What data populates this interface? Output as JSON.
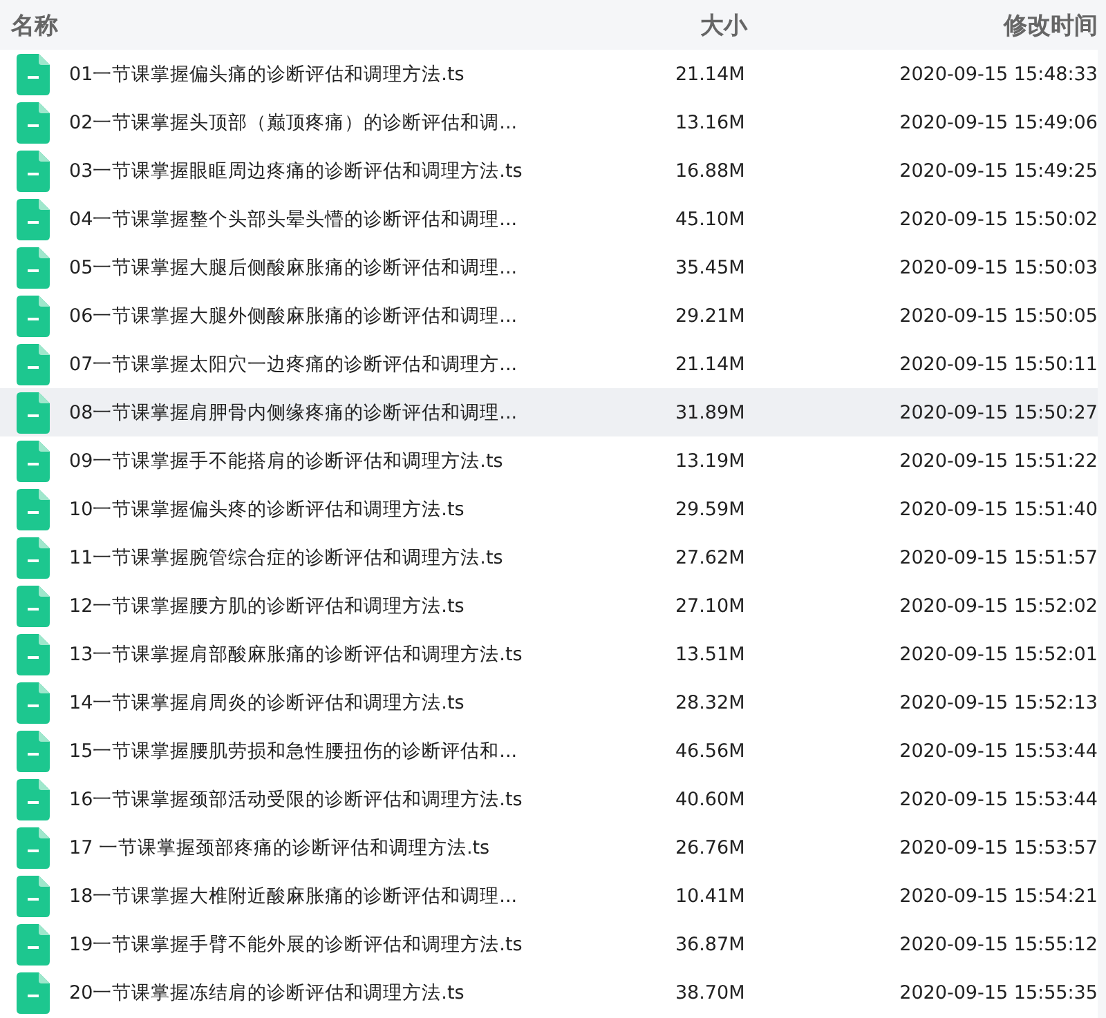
{
  "columns": [
    "名称",
    "大小",
    "修改时间"
  ],
  "files": [
    {
      "name": "01一节课掌握偏头痛的诊断评估和调理方法.ts",
      "size": "21.14M",
      "modified": "2020-09-15 15:48:33",
      "selected": false
    },
    {
      "name": "02一节课掌握头顶部（巅顶疼痛）的诊断评估和调...",
      "size": "13.16M",
      "modified": "2020-09-15 15:49:06",
      "selected": false
    },
    {
      "name": "03一节课掌握眼眶周边疼痛的诊断评估和调理方法.ts",
      "size": "16.88M",
      "modified": "2020-09-15 15:49:25",
      "selected": false
    },
    {
      "name": "04一节课掌握整个头部头晕头懵的诊断评估和调理...",
      "size": "45.10M",
      "modified": "2020-09-15 15:50:02",
      "selected": false
    },
    {
      "name": "05一节课掌握大腿后侧酸麻胀痛的诊断评估和调理...",
      "size": "35.45M",
      "modified": "2020-09-15 15:50:03",
      "selected": false
    },
    {
      "name": "06一节课掌握大腿外侧酸麻胀痛的诊断评估和调理...",
      "size": "29.21M",
      "modified": "2020-09-15 15:50:05",
      "selected": false
    },
    {
      "name": "07一节课掌握太阳穴一边疼痛的诊断评估和调理方...",
      "size": "21.14M",
      "modified": "2020-09-15 15:50:11",
      "selected": false
    },
    {
      "name": "08一节课掌握肩胛骨内侧缘疼痛的诊断评估和调理...",
      "size": "31.89M",
      "modified": "2020-09-15 15:50:27",
      "selected": true
    },
    {
      "name": "09一节课掌握手不能搭肩的诊断评估和调理方法.ts",
      "size": "13.19M",
      "modified": "2020-09-15 15:51:22",
      "selected": false
    },
    {
      "name": "10一节课掌握偏头疼的诊断评估和调理方法.ts",
      "size": "29.59M",
      "modified": "2020-09-15 15:51:40",
      "selected": false
    },
    {
      "name": "11一节课掌握腕管综合症的诊断评估和调理方法.ts",
      "size": "27.62M",
      "modified": "2020-09-15 15:51:57",
      "selected": false
    },
    {
      "name": "12一节课掌握腰方肌的诊断评估和调理方法.ts",
      "size": "27.10M",
      "modified": "2020-09-15 15:52:02",
      "selected": false
    },
    {
      "name": "13一节课掌握肩部酸麻胀痛的诊断评估和调理方法.ts",
      "size": "13.51M",
      "modified": "2020-09-15 15:52:01",
      "selected": false
    },
    {
      "name": "14一节课掌握肩周炎的诊断评估和调理方法.ts",
      "size": "28.32M",
      "modified": "2020-09-15 15:52:13",
      "selected": false
    },
    {
      "name": "15一节课掌握腰肌劳损和急性腰扭伤的诊断评估和...",
      "size": "46.56M",
      "modified": "2020-09-15 15:53:44",
      "selected": false
    },
    {
      "name": "16一节课掌握颈部活动受限的诊断评估和调理方法.ts",
      "size": "40.60M",
      "modified": "2020-09-15 15:53:44",
      "selected": false
    },
    {
      "name": "17 一节课掌握颈部疼痛的诊断评估和调理方法.ts",
      "size": "26.76M",
      "modified": "2020-09-15 15:53:57",
      "selected": false
    },
    {
      "name": "18一节课掌握大椎附近酸麻胀痛的诊断评估和调理...",
      "size": "10.41M",
      "modified": "2020-09-15 15:54:21",
      "selected": false
    },
    {
      "name": "19一节课掌握手臂不能外展的诊断评估和调理方法.ts",
      "size": "36.87M",
      "modified": "2020-09-15 15:55:12",
      "selected": false
    },
    {
      "name": "20一节课掌握冻结肩的诊断评估和调理方法.ts",
      "size": "38.70M",
      "modified": "2020-09-15 15:55:35",
      "selected": false
    }
  ]
}
